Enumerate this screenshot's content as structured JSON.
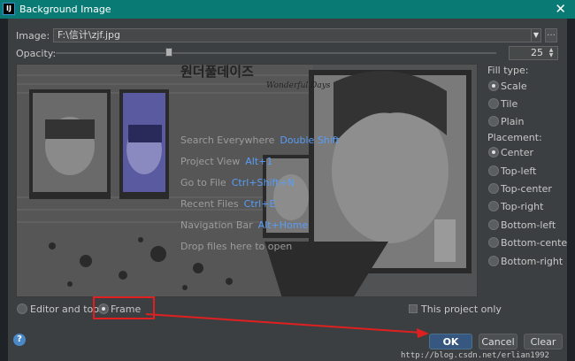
{
  "window": {
    "title": "Background Image",
    "app_icon": "IJ"
  },
  "form": {
    "image_label": "Image:",
    "image_value": "F:\\信计\\zjf.jpg",
    "opacity_label": "Opacity:",
    "opacity_value": "25",
    "opacity_fraction": 0.25
  },
  "hints": [
    {
      "text": "Search Everywhere",
      "key": "Double Shift"
    },
    {
      "text": "Project View",
      "key": "Alt+1"
    },
    {
      "text": "Go to File",
      "key": "Ctrl+Shift+N"
    },
    {
      "text": "Recent Files",
      "key": "Ctrl+E"
    },
    {
      "text": "Navigation Bar",
      "key": "Alt+Home"
    },
    {
      "text": "Drop files here to open",
      "key": ""
    }
  ],
  "preview": {
    "poster_text": "원더풀데이즈",
    "poster_subtext": "Wonderful Days"
  },
  "fill_type": {
    "label": "Fill type:",
    "options": [
      "Scale",
      "Tile",
      "Plain"
    ],
    "selected": "Scale"
  },
  "placement": {
    "label": "Placement:",
    "options": [
      "Center",
      "Top-left",
      "Top-center",
      "Top-right",
      "Bottom-left",
      "Bottom-center",
      "Bottom-right"
    ],
    "selected": "Center"
  },
  "target": {
    "options": [
      "Editor and tools",
      "Frame"
    ],
    "selected": "Frame"
  },
  "this_project_only": {
    "label": "This project only",
    "checked": false
  },
  "buttons": {
    "ok": "OK",
    "cancel": "Cancel",
    "clear": "Clear",
    "help": "?"
  },
  "watermark": "http://blog.csdn.net/erlian1992",
  "colors": {
    "titlebar": "#0a7b74",
    "accent": "#589df6",
    "ok_button": "#365880",
    "highlight": "#e02020"
  }
}
